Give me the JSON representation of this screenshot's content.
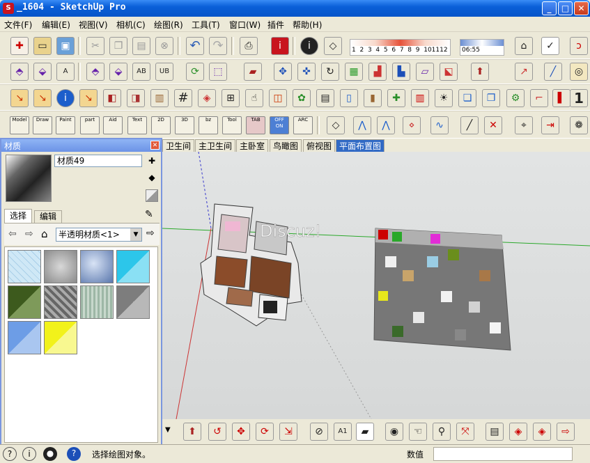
{
  "window": {
    "title": "_1604 - SketchUp Pro",
    "min": "_",
    "max": "□",
    "close": "✕"
  },
  "menu": [
    "文件(F)",
    "编辑(E)",
    "视图(V)",
    "相机(C)",
    "绘图(R)",
    "工具(T)",
    "窗口(W)",
    "插件",
    "帮助(H)"
  ],
  "shadow_bar": {
    "months": [
      "1",
      "2",
      "3",
      "4",
      "5",
      "6",
      "7",
      "8",
      "9",
      "10",
      "11",
      "12"
    ],
    "time": "06:55",
    "checkbox": "✓"
  },
  "mini_tools": [
    {
      "label": "Model"
    },
    {
      "label": "Draw"
    },
    {
      "label": "Paint"
    },
    {
      "label": "part"
    },
    {
      "label": "Aid"
    },
    {
      "label": "Text"
    },
    {
      "label": "2D"
    },
    {
      "label": "3D"
    },
    {
      "label": "bz"
    },
    {
      "label": "Tool"
    },
    {
      "label": "TAB"
    },
    {
      "label": "OFF ON"
    },
    {
      "label": "ARC"
    }
  ],
  "material_panel": {
    "title": "材质",
    "name_value": "材质49",
    "tabs": [
      "选择",
      "编辑"
    ],
    "library": "半透明材质<1>",
    "swatch_colors": [
      "#cfe8f6",
      "#b5b5b5",
      "#8ea8d4",
      "#2cc6ea",
      "#3d5a1d",
      "#888888",
      "#9db7a6",
      "#7d7d7d",
      "#6d9de6",
      "#f2f21a"
    ]
  },
  "scene_tabs": [
    "卫生间",
    "主卫生间",
    "主卧室",
    "鸟瞰图",
    "俯视图",
    "平面布置图"
  ],
  "active_scene": "平面布置图",
  "watermark": "Discuz!",
  "status": {
    "hint": "选择绘图对象。",
    "measure_label": "数值",
    "measure_value": ""
  },
  "icons": [
    "new-icon",
    "open-icon",
    "save-icon",
    "cut-icon",
    "copy-icon",
    "paste-icon",
    "erase-icon",
    "undo-icon",
    "redo-icon",
    "print-icon",
    "model-info-icon",
    "shadow-icon",
    "fog-icon",
    "warehouse-icon",
    "help-icon",
    "component-icon",
    "orbit-icon",
    "pan-icon",
    "zoom-icon",
    "zoom-extents-icon",
    "walk-icon",
    "look-around-icon"
  ]
}
